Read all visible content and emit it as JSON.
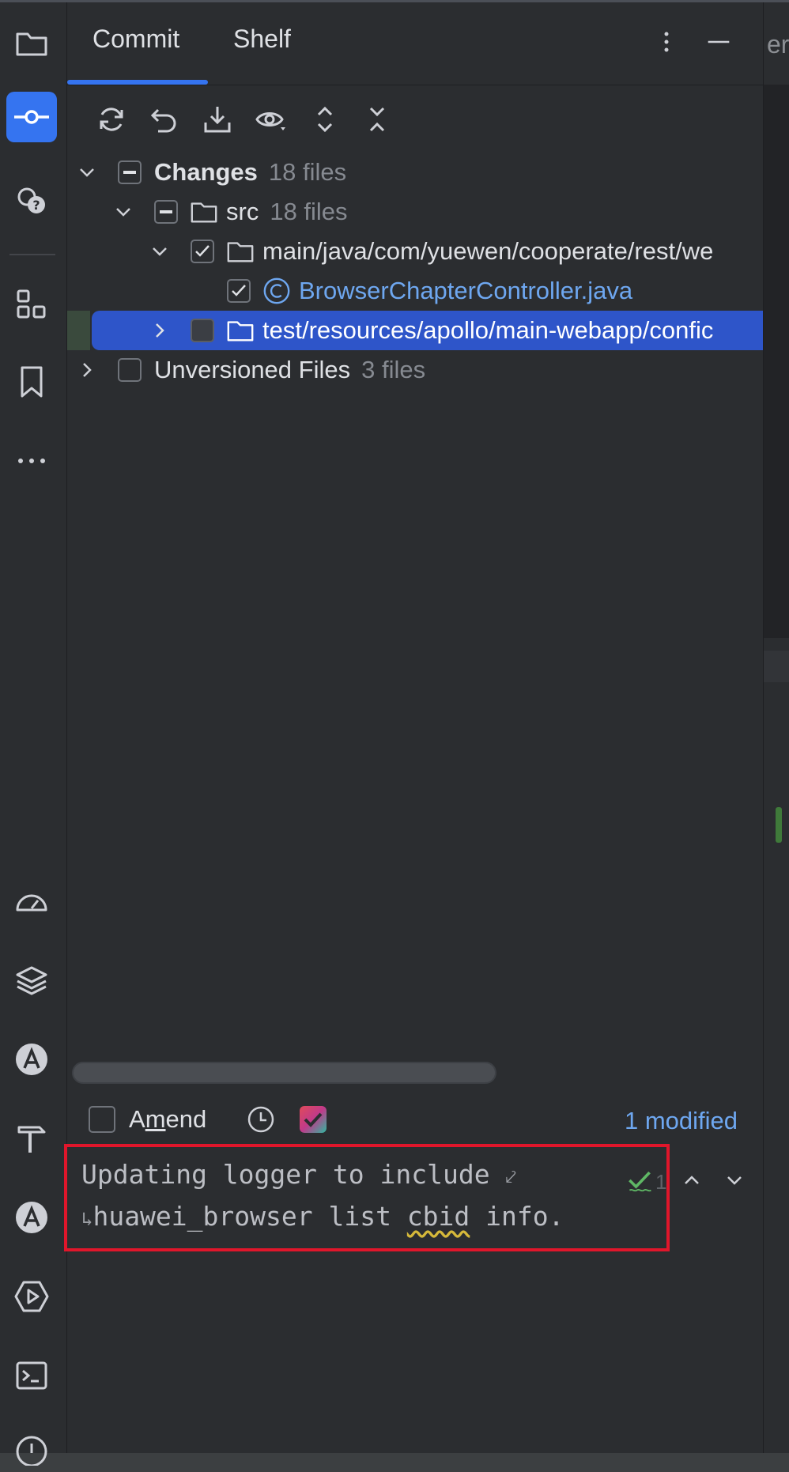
{
  "tabs": {
    "commit": "Commit",
    "shelf": "Shelf",
    "next_tab_fragment": "er"
  },
  "tree": {
    "changes": {
      "label": "Changes",
      "count": "18 files"
    },
    "src": {
      "label": "src",
      "count": "18 files"
    },
    "main_path": {
      "label": "main/java/com/yuewen/cooperate/rest/we"
    },
    "file": {
      "label": "BrowserChapterController.java"
    },
    "test_path": {
      "label": "test/resources/apollo/main-webapp/confic"
    },
    "unversioned": {
      "label": "Unversioned Files",
      "count": "3 files"
    }
  },
  "commit": {
    "amend_prefix": "A",
    "amend_underlined": "m",
    "amend_suffix": "end",
    "modified": "1 modified",
    "inspection_count": "1",
    "message_line1": "Updating logger to include ",
    "message_line2_a": "huawei_browser list ",
    "message_line2_b": "cbid",
    "message_line2_c": " info."
  },
  "colors": {
    "accent": "#3574f0",
    "selection": "#2e55c9",
    "highlight_box": "#e0162b",
    "ok_green": "#5fb865",
    "link_blue": "#6ea7f0"
  },
  "icons": [
    "folder-icon",
    "commit-icon",
    "copilot-chat-icon",
    "structure-icon",
    "bookmark-icon",
    "more-icon",
    "profiler-icon",
    "layers-icon",
    "ai-assistant-icon",
    "build-icon",
    "ai-icon",
    "run-icon",
    "terminal-icon",
    "problems-icon"
  ]
}
